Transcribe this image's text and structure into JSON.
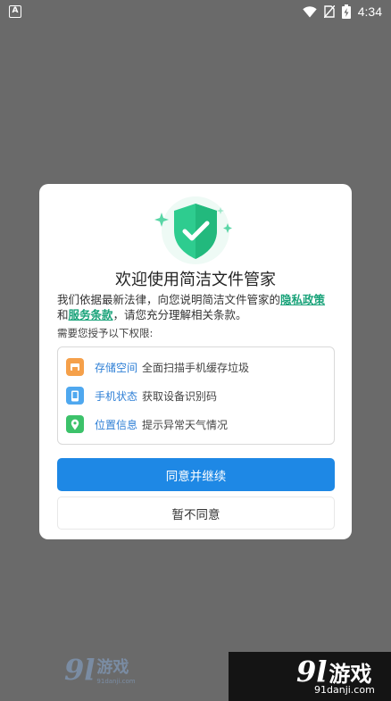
{
  "status_bar": {
    "app_icon": "A",
    "time": "4:34",
    "icons": [
      "wifi-icon",
      "no-sim-icon",
      "battery-charging-icon"
    ]
  },
  "dialog": {
    "title": "欢迎使用简洁文件管家",
    "intro_prefix": "我们依据最新法律，向您说明简洁文件管家的",
    "privacy_link": "隐私政策",
    "and_text": "和",
    "terms_link": "服务条款",
    "intro_suffix": "，请您充分理解相关条款。",
    "permissions_hint": "需要您授予以下权限:",
    "permissions": [
      {
        "name": "存储空间",
        "desc": "全面扫描手机缓存垃圾",
        "icon": "storage-icon",
        "color": "#f5a04a"
      },
      {
        "name": "手机状态",
        "desc": "获取设备识别码",
        "icon": "phone-icon",
        "color": "#4fa8ef"
      },
      {
        "name": "位置信息",
        "desc": "提示异常天气情况",
        "icon": "location-icon",
        "color": "#3cc26a"
      }
    ],
    "agree_button": "同意并继续",
    "disagree_button": "暂不同意",
    "accent_color": "#1e88e5",
    "shield_color": "#2ecc8f"
  },
  "watermark": {
    "brand_num": "9l",
    "brand_text": "游戏",
    "domain": "91danji.com"
  }
}
